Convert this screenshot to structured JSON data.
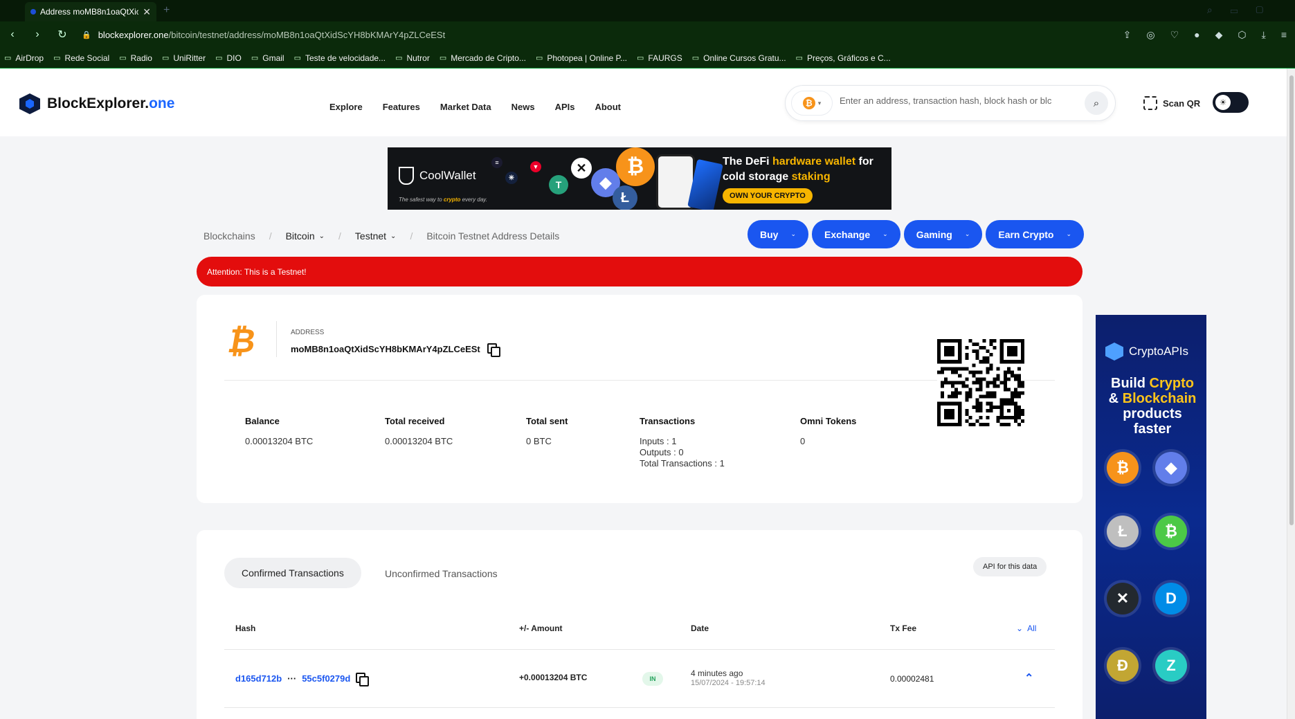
{
  "browser": {
    "tab_title": "Address moMB8n1oaQtXic",
    "url_host": "blockexplorer.one",
    "url_path": "/bitcoin/testnet/address/moMB8n1oaQtXidScYH8bKMArY4pZLCeESt",
    "bookmarks": [
      "AirDrop",
      "Rede Social",
      "Radio",
      "UniRitter",
      "DIO",
      "Gmail",
      "Teste de velocidade...",
      "Nutror",
      "Mercado de Cripto...",
      "Photopea | Online P...",
      "FAURGS",
      "Online Cursos Gratu...",
      "Preços, Gráficos e C..."
    ]
  },
  "header": {
    "logo_main": "BlockExplorer.",
    "logo_accent": "one",
    "nav": [
      "Explore",
      "Features",
      "Market Data",
      "News",
      "APIs",
      "About"
    ],
    "search_placeholder": "Enter an address, transaction hash, block hash or blc",
    "scan_qr": "Scan QR"
  },
  "banner_ad": {
    "brand": "CoolWallet",
    "tagline_pre": "The safest way to ",
    "tagline_mid": "crypto",
    "tagline_post": " every day.",
    "headline_1": "The DeFi ",
    "headline_2": "hardware wallet",
    "headline_3": " for",
    "headline_4": "cold storage ",
    "headline_5": "staking",
    "cta": "OWN YOUR CRYPTO"
  },
  "breadcrumb": {
    "root": "Blockchains",
    "chain": "Bitcoin",
    "network": "Testnet",
    "current": "Bitcoin Testnet Address Details"
  },
  "action_buttons": [
    "Buy",
    "Exchange",
    "Gaming",
    "Earn Crypto"
  ],
  "alert": "Attention: This is a Testnet!",
  "address_card": {
    "label": "ADDRESS",
    "address": "moMB8n1oaQtXidScYH8bKMArY4pZLCeESt",
    "stats": {
      "balance_label": "Balance",
      "balance": "0.00013204 BTC",
      "received_label": "Total received",
      "received": "0.00013204 BTC",
      "sent_label": "Total sent",
      "sent": "0 BTC",
      "tx_label": "Transactions",
      "inputs": "Inputs : 1",
      "outputs": "Outputs : 0",
      "total_tx": "Total Transactions : 1",
      "omni_label": "Omni Tokens",
      "omni": "0"
    }
  },
  "transactions": {
    "tab_confirmed": "Confirmed Transactions",
    "tab_unconfirmed": "Unconfirmed Transactions",
    "api_button": "API for this data",
    "columns": {
      "hash": "Hash",
      "amount": "+/- Amount",
      "date": "Date",
      "fee": "Tx Fee",
      "all": "All"
    },
    "rows": [
      {
        "hash_start": "d165d712b",
        "hash_sep": "···",
        "hash_end": "55c5f0279d",
        "amount": "+0.00013204 BTC",
        "direction": "IN",
        "date_relative": "4 minutes ago",
        "date_full": "15/07/2024 - 19:57:14",
        "fee": "0.00002481"
      }
    ]
  },
  "side_ad": {
    "brand": "CryptoAPIs",
    "line1a": "Build ",
    "line1b": "Crypto",
    "line2a": "& ",
    "line2b": "Blockchain",
    "line3": "products faster"
  },
  "colors": {
    "accent": "#1a56f0",
    "alert": "#e30d0d",
    "bitcoin": "#f7931a",
    "browser_bg": "#0b2a0b"
  }
}
